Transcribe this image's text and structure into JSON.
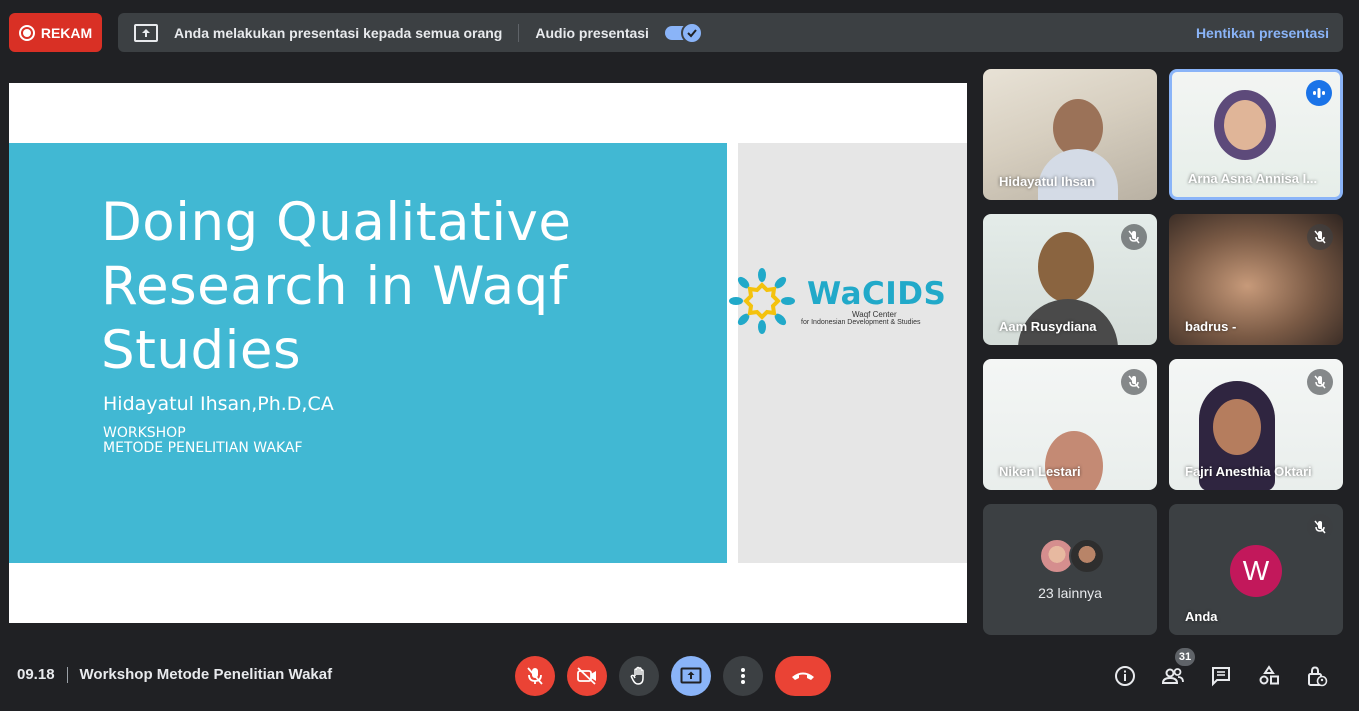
{
  "top_bar": {
    "record_label": "REKAM",
    "presenting_text": "Anda melakukan presentasi kepada semua orang",
    "audio_label": "Audio presentasi",
    "stop_label": "Hentikan presentasi"
  },
  "slide": {
    "title_lines": [
      "Doing Qualitative",
      "Research in Waqf",
      "Studies"
    ],
    "author": "Hidayatul Ihsan,Ph.D,CA",
    "workshop_line1": "WORKSHOP",
    "workshop_line2": "METODE PENELITIAN WAKAF",
    "logo_name": "WaCIDS",
    "logo_sub1": "Waqf Center",
    "logo_sub2": "for Indonesian Development & Studies"
  },
  "participants": [
    {
      "name": "Hidayatul Ihsan",
      "muted": false
    },
    {
      "name": "Arna Asna Annisa I...",
      "muted": false,
      "speaking": true
    },
    {
      "name": "Aam Rusydiana",
      "muted": true
    },
    {
      "name": "badrus -",
      "muted": true
    },
    {
      "name": "Niken Lestari",
      "muted": true
    },
    {
      "name": "Fajri Anesthia Oktari",
      "muted": true
    }
  ],
  "others": {
    "label": "23 lainnya"
  },
  "self_tile": {
    "name": "Anda",
    "initial": "W"
  },
  "bottom_bar": {
    "time": "09.18",
    "meeting_title": "Workshop Metode Penelitian Wakaf",
    "participant_count": "31"
  },
  "colors": {
    "record_red": "#d93025",
    "accent_blue": "#8ab4f8",
    "slide_teal": "#41b8d3",
    "end_call_red": "#ea4335",
    "avatar_pink": "#c2185b"
  }
}
